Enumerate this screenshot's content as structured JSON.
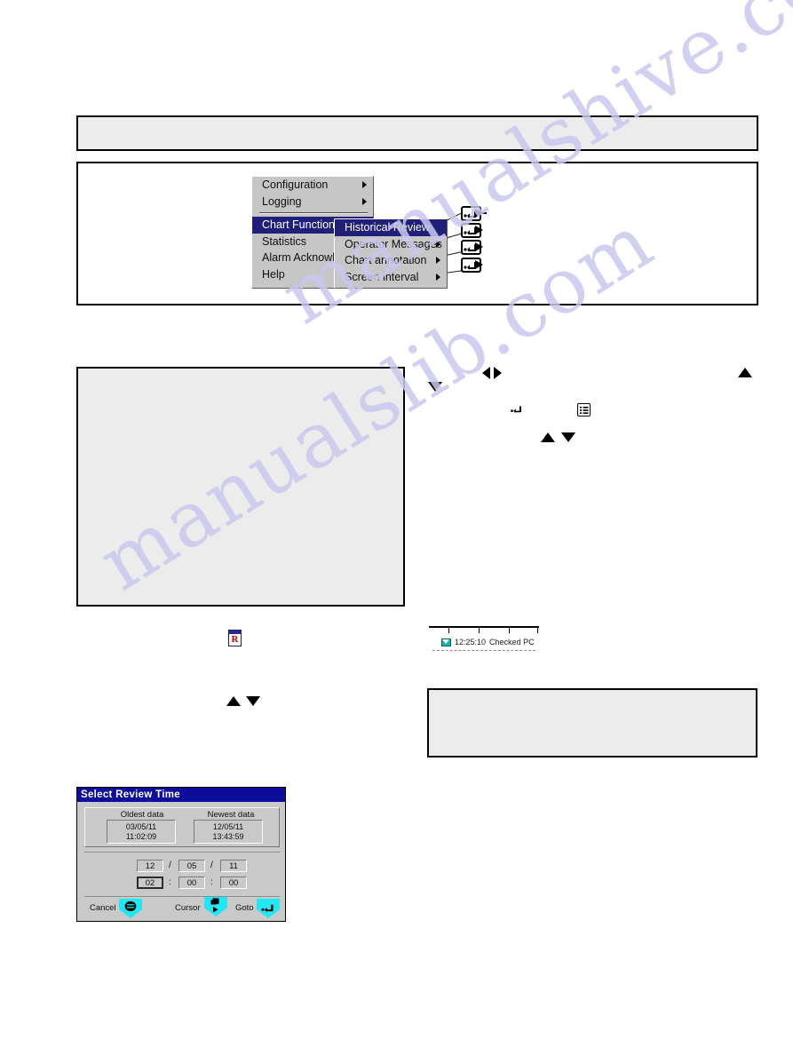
{
  "page": {
    "background": "#ffffff",
    "watermark_text_1": "manualshive.com",
    "watermark_text_2": "manualslib.com"
  },
  "top_note_box": {
    "name": "note-banner",
    "text": ""
  },
  "menu_figure": {
    "main_menu": {
      "items": [
        {
          "label": "Configuration",
          "has_submenu": true,
          "selected": false
        },
        {
          "label": "Logging",
          "has_submenu": true,
          "selected": false
        },
        {
          "separator": true
        },
        {
          "label": "Chart Function",
          "has_submenu": true,
          "selected": true
        },
        {
          "label": "Statistics",
          "has_submenu": false,
          "selected": false
        },
        {
          "label": "Alarm Acknowl",
          "has_submenu": false,
          "selected": false
        },
        {
          "label": "Help",
          "has_submenu": false,
          "selected": false
        }
      ]
    },
    "submenu": {
      "items": [
        {
          "label": "Historical Review",
          "has_submenu": true,
          "selected": true
        },
        {
          "label": "Operator Messages",
          "has_submenu": true,
          "selected": false
        },
        {
          "label": "Chart annotation",
          "has_submenu": true,
          "selected": false
        },
        {
          "label": "Screen interval",
          "has_submenu": true,
          "selected": false
        }
      ]
    },
    "callouts": [
      {
        "icon": "enter-key-icon"
      },
      {
        "icon": "enter-key-icon"
      },
      {
        "icon": "enter-key-icon"
      },
      {
        "icon": "enter-key-icon"
      }
    ],
    "highlight_color": "#20207a",
    "menu_background": "#c6c6c6"
  },
  "screen_placeholder": {
    "name": "chart-screen-image",
    "text": ""
  },
  "right_note_box": {
    "name": "note-box",
    "text": ""
  },
  "inline_icons": [
    {
      "name": "triangle-down-icon",
      "glyph": "▼"
    },
    {
      "name": "triangle-left-icon",
      "glyph": "◀"
    },
    {
      "name": "triangle-right-icon",
      "glyph": "▶"
    },
    {
      "name": "triangle-up-icon",
      "glyph": "▲"
    },
    {
      "name": "enter-key-icon",
      "glyph": "↵"
    },
    {
      "name": "menu-list-icon",
      "glyph": "▤"
    },
    {
      "name": "triangle-up-icon",
      "glyph": "▲"
    },
    {
      "name": "triangle-down-icon",
      "glyph": "▼"
    },
    {
      "name": "review-mode-icon",
      "glyph": "R"
    },
    {
      "name": "triangle-up-icon",
      "glyph": "▲"
    },
    {
      "name": "triangle-down-icon",
      "glyph": "▼"
    }
  ],
  "review_icon": {
    "name": "historical-review-mode-icon",
    "letter": "R"
  },
  "message_strip": {
    "name": "operator-message-strip",
    "icon": "envelope-icon",
    "timestamp": "12:25:10",
    "message": "Checked PC"
  },
  "dialog": {
    "title": "Select Review Time",
    "title_bar_color": "#0d0d9b",
    "face_color": "#c9c9c9",
    "data_range": {
      "oldest_label": "Oldest data",
      "oldest_date": "03/05/11",
      "oldest_time": "11:02:09",
      "newest_label": "Newest data",
      "newest_date": "12/05/11",
      "newest_time": "13:43:59"
    },
    "entry": {
      "date": {
        "day": "12",
        "month": "05",
        "year": "11",
        "sep": "/"
      },
      "time": {
        "hour": "02",
        "minute": "00",
        "second": "00",
        "sep": ":"
      },
      "focused_field": "hour"
    },
    "buttons": [
      {
        "label": "Cancel",
        "icon": "menu-key-icon",
        "key_color": "#22e6f2"
      },
      {
        "label": "Cursor",
        "icon": "cursor-key-icon",
        "key_color": "#22e6f2"
      },
      {
        "label": "Goto",
        "icon": "enter-key-icon",
        "key_color": "#22e6f2"
      }
    ]
  }
}
